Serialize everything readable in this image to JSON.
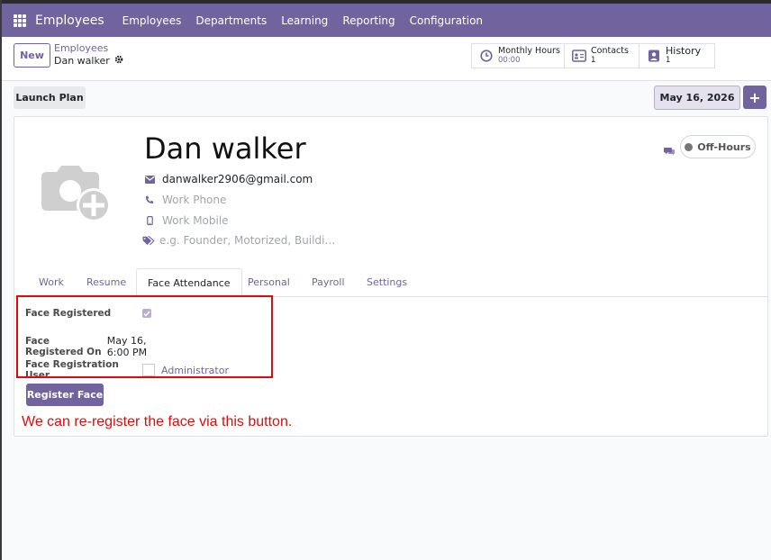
{
  "navbar": {
    "app_name": "Employees",
    "menu": [
      "Employees",
      "Departments",
      "Learning",
      "Reporting",
      "Configuration"
    ]
  },
  "control_panel": {
    "new_label": "New",
    "breadcrumb_parent": "Employees",
    "breadcrumb_current": "Dan walker",
    "stats": [
      {
        "label": "Monthly Hours",
        "value": "00:00",
        "icon": "clock-icon"
      },
      {
        "label": "Contacts",
        "value": "1",
        "icon": "address-card-icon"
      },
      {
        "label": "History",
        "value": "1",
        "icon": "user-history-icon"
      }
    ]
  },
  "toolbar": {
    "launch_plan_label": "Launch Plan",
    "date_label": "May 16, 2026",
    "add_label": "+"
  },
  "employee": {
    "name": "Dan walker",
    "email": "danwalker2906@gmail.com",
    "work_phone_placeholder": "Work Phone",
    "work_mobile_placeholder": "Work Mobile",
    "tags_placeholder": "e.g. Founder, Motorized, Buildi…",
    "status": "Off-Hours"
  },
  "tabs": [
    {
      "label": "Work",
      "active": false
    },
    {
      "label": "Resume",
      "active": false
    },
    {
      "label": "Face Attendance",
      "active": true
    },
    {
      "label": "Personal",
      "active": false
    },
    {
      "label": "Payroll",
      "active": false
    },
    {
      "label": "Settings",
      "active": false
    }
  ],
  "face_attendance": {
    "registered_label": "Face Registered",
    "registered_checked": true,
    "registered_on_label": "Face Registered On",
    "registered_on_value": "May 16, 6:00 PM",
    "user_label": "Face Registration User",
    "user_value": "Administrator",
    "register_button": "Register Face"
  },
  "annotation_note": "We can re-register the face via this button.",
  "colors": {
    "brand": "#71639e",
    "annotation_red": "#e10a0a"
  }
}
